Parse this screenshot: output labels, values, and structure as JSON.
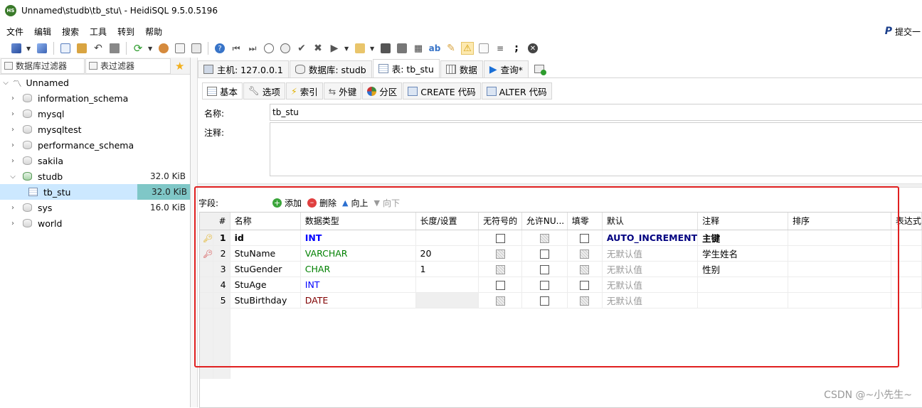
{
  "window": {
    "title": "Unnamed\\studb\\tb_stu\\ - HeidiSQL 9.5.0.5196",
    "logo_text": "HS"
  },
  "menu": {
    "items": [
      "文件",
      "编辑",
      "搜索",
      "工具",
      "转到",
      "帮助"
    ],
    "right_label": "提交一"
  },
  "toolbar": {
    "icons": [
      "connect-icon",
      "disconnect-icon",
      "copy-icon",
      "paste-icon",
      "undo-icon",
      "print-icon",
      "refresh-icon",
      "user-manager-icon",
      "export-icon",
      "import-icon",
      "help-icon",
      "first-icon",
      "prev-icon",
      "add-icon",
      "remove-icon",
      "check-icon",
      "cancel-icon",
      "run-icon",
      "load-sql-icon",
      "save-icon",
      "save-as-icon",
      "find-icon",
      "replace-icon",
      "edit-icon",
      "warning-icon",
      "stop-icon",
      "format-icon",
      "semicolon-icon",
      "close-icon"
    ]
  },
  "left_panel": {
    "db_filter_label": "数据库过滤器",
    "table_filter_label": "表过滤器",
    "tree": {
      "root": "Unnamed",
      "databases": [
        {
          "name": "information_schema",
          "size": ""
        },
        {
          "name": "mysql",
          "size": ""
        },
        {
          "name": "mysqltest",
          "size": ""
        },
        {
          "name": "performance_schema",
          "size": ""
        },
        {
          "name": "sakila",
          "size": ""
        },
        {
          "name": "studb",
          "size": "32.0 KiB"
        },
        {
          "name": "sys",
          "size": "16.0 KiB"
        },
        {
          "name": "world",
          "size": ""
        }
      ],
      "selected_table": {
        "name": "tb_stu",
        "size": "32.0 KiB"
      }
    }
  },
  "tabs": {
    "host": "主机: 127.0.0.1",
    "database": "数据库: studb",
    "table": "表: tb_stu",
    "data": "数据",
    "query": "查询*"
  },
  "subtabs": [
    "基本",
    "选项",
    "索引",
    "外键",
    "分区",
    "CREATE 代码",
    "ALTER 代码"
  ],
  "form": {
    "name_label": "名称:",
    "name_value": "tb_stu",
    "comment_label": "注释:",
    "comment_value": ""
  },
  "fields_bar": {
    "label": "字段:",
    "add": "添加",
    "delete": "删除",
    "up": "向上",
    "down": "向下"
  },
  "grid": {
    "headers": [
      "#",
      "名称",
      "数据类型",
      "长度/设置",
      "无符号的",
      "允许NU...",
      "填零",
      "默认",
      "注释",
      "排序",
      "表达式"
    ],
    "rows": [
      {
        "num": "1",
        "name": "id",
        "type": "INT",
        "length": "",
        "unsigned": false,
        "allow_null": false,
        "zerofill": false,
        "default": "AUTO_INCREMENT",
        "comment": "主键",
        "collation": "",
        "key": "primary"
      },
      {
        "num": "2",
        "name": "StuName",
        "type": "VARCHAR",
        "length": "20",
        "unsigned": false,
        "allow_null": false,
        "zerofill": false,
        "default": "无默认值",
        "comment": "学生姓名",
        "collation": "",
        "key": "unique"
      },
      {
        "num": "3",
        "name": "StuGender",
        "type": "CHAR",
        "length": "1",
        "unsigned": false,
        "allow_null": false,
        "zerofill": false,
        "default": "无默认值",
        "comment": "性别",
        "collation": "",
        "key": ""
      },
      {
        "num": "4",
        "name": "StuAge",
        "type": "INT",
        "length": "",
        "unsigned": false,
        "allow_null": false,
        "zerofill": false,
        "default": "无默认值",
        "comment": "",
        "collation": "",
        "key": ""
      },
      {
        "num": "5",
        "name": "StuBirthday",
        "type": "DATE",
        "length": "",
        "unsigned": false,
        "allow_null": false,
        "zerofill": false,
        "default": "无默认值",
        "comment": "",
        "collation": "",
        "key": ""
      }
    ]
  },
  "watermark": "CSDN @~小先生~",
  "colors": {
    "highlight_box": "#e02020",
    "selected_row": "#cce8ff",
    "int_type": "#0000ff",
    "varchar_type": "#008000",
    "date_type": "#800000"
  }
}
